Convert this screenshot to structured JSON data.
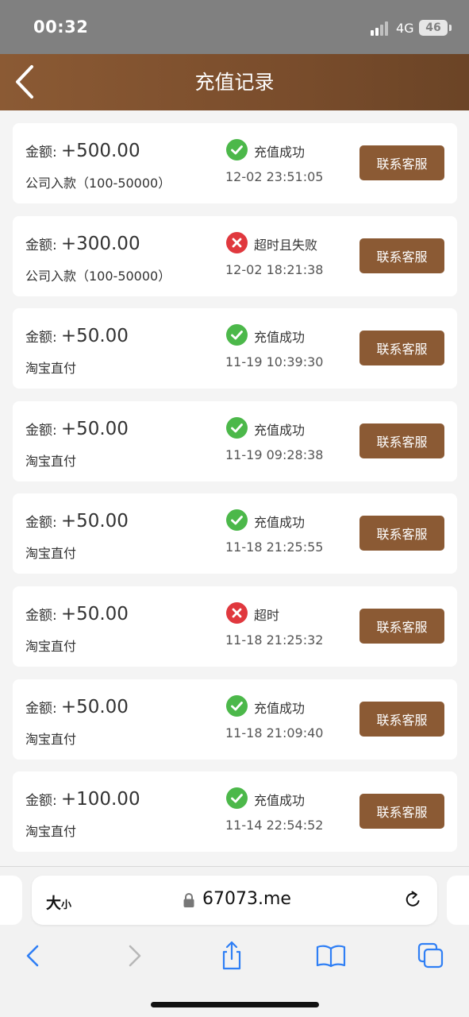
{
  "status_bar": {
    "time": "00:32",
    "network": "4G",
    "battery": "46"
  },
  "header": {
    "title": "充值记录"
  },
  "records": [
    {
      "amount_label": "金额:",
      "amount": "+500.00",
      "method": "公司入款（100-50000）",
      "status": "充值成功",
      "status_type": "success",
      "time": "12-02 23:51:05",
      "button": "联系客服"
    },
    {
      "amount_label": "金额:",
      "amount": "+300.00",
      "method": "公司入款（100-50000）",
      "status": "超时且失败",
      "status_type": "fail",
      "time": "12-02 18:21:38",
      "button": "联系客服"
    },
    {
      "amount_label": "金额:",
      "amount": "+50.00",
      "method": "淘宝直付",
      "status": "充值成功",
      "status_type": "success",
      "time": "11-19 10:39:30",
      "button": "联系客服"
    },
    {
      "amount_label": "金额:",
      "amount": "+50.00",
      "method": "淘宝直付",
      "status": "充值成功",
      "status_type": "success",
      "time": "11-19 09:28:38",
      "button": "联系客服"
    },
    {
      "amount_label": "金额:",
      "amount": "+50.00",
      "method": "淘宝直付",
      "status": "充值成功",
      "status_type": "success",
      "time": "11-18 21:25:55",
      "button": "联系客服"
    },
    {
      "amount_label": "金额:",
      "amount": "+50.00",
      "method": "淘宝直付",
      "status": "超时",
      "status_type": "fail",
      "time": "11-18 21:25:32",
      "button": "联系客服"
    },
    {
      "amount_label": "金额:",
      "amount": "+50.00",
      "method": "淘宝直付",
      "status": "充值成功",
      "status_type": "success",
      "time": "11-18 21:09:40",
      "button": "联系客服"
    },
    {
      "amount_label": "金额:",
      "amount": "+100.00",
      "method": "淘宝直付",
      "status": "充值成功",
      "status_type": "success",
      "time": "11-14 22:54:52",
      "button": "联系客服"
    }
  ],
  "browser": {
    "aa_big": "大",
    "aa_small": "小",
    "url": "67073.me",
    "toolbar": [
      "back-icon",
      "forward-icon",
      "share-icon",
      "bookmarks-icon",
      "tabs-icon"
    ]
  },
  "colors": {
    "brand": "#8b5a34",
    "success": "#4cb84a",
    "fail": "#e0383e",
    "ios_blue": "#2f7ff5"
  }
}
